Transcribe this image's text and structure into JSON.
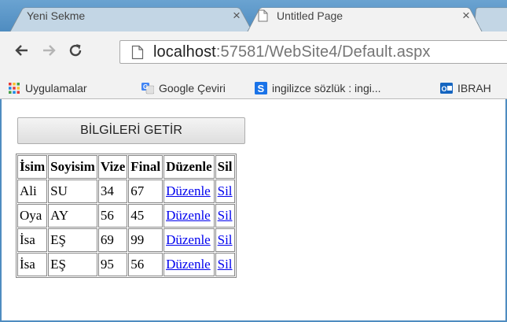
{
  "browser": {
    "tabs": [
      {
        "title": "Yeni Sekme",
        "close": "×"
      },
      {
        "title": "Untitled Page",
        "close": "×"
      }
    ],
    "url": {
      "host": "localhost",
      "path": ":57581/WebSite4/Default.aspx"
    },
    "bookmarks": [
      {
        "label": "Uygulamalar",
        "icon": "apps-grid-icon"
      },
      {
        "label": "Google Çeviri",
        "icon": "google-translate-icon"
      },
      {
        "label": "ingilizce sözlük : ingi...",
        "icon": "s-logo-icon"
      },
      {
        "label": "IBRAH",
        "icon": "outlook-icon"
      }
    ]
  },
  "page": {
    "fetch_button": "BİLGİLERİ GETİR",
    "table": {
      "headers": [
        "İsim",
        "Soyisim",
        "Vize",
        "Final",
        "Düzenle",
        "Sil"
      ],
      "rows": [
        {
          "isim": "Ali",
          "soyisim": "SU",
          "vize": "34",
          "final": "67",
          "edit": "Düzenle",
          "delete": "Sil"
        },
        {
          "isim": "Oya",
          "soyisim": "AY",
          "vize": "56",
          "final": "45",
          "edit": "Düzenle",
          "delete": "Sil"
        },
        {
          "isim": "İsa",
          "soyisim": "EŞ",
          "vize": "69",
          "final": "99",
          "edit": "Düzenle",
          "delete": "Sil"
        },
        {
          "isim": "İsa",
          "soyisim": "EŞ",
          "vize": "95",
          "final": "56",
          "edit": "Düzenle",
          "delete": "Sil"
        }
      ]
    }
  },
  "colors": {
    "tabstrip": "#5f9ac9",
    "link": "#0000ee",
    "window_border": "#4f8cc0"
  }
}
